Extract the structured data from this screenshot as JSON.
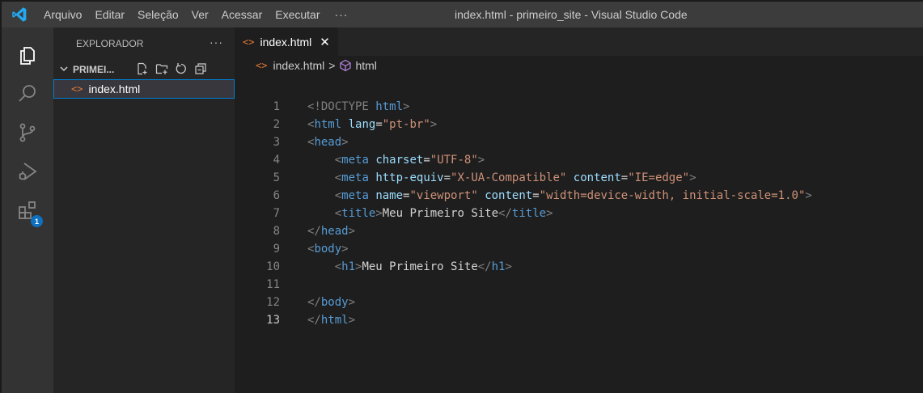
{
  "titlebar": {
    "menu": [
      "Arquivo",
      "Editar",
      "Seleção",
      "Ver",
      "Acessar",
      "Executar"
    ],
    "more": "···",
    "window_title": "index.html - primeiro_site - Visual Studio Code"
  },
  "activitybar": {
    "icons": [
      "explorer-icon",
      "search-icon",
      "source-control-icon",
      "run-debug-icon",
      "extensions-icon"
    ],
    "extensions_badge": "1"
  },
  "sidebar": {
    "title": "EXPLORADOR",
    "more": "···",
    "section": "PRIMEI...",
    "files": [
      {
        "name": "index.html",
        "selected": true
      }
    ]
  },
  "editor": {
    "tab": {
      "label": "index.html",
      "close": "✕"
    },
    "breadcrumb": {
      "file": "index.html",
      "sep": ">",
      "symbol": "html"
    },
    "active_line": 13,
    "lines": [
      {
        "n": "1"
      },
      {
        "n": "2"
      },
      {
        "n": "3"
      },
      {
        "n": "4"
      },
      {
        "n": "5"
      },
      {
        "n": "6"
      },
      {
        "n": "7"
      },
      {
        "n": "8"
      },
      {
        "n": "9"
      },
      {
        "n": "10"
      },
      {
        "n": "11"
      },
      {
        "n": "12"
      },
      {
        "n": "13"
      }
    ],
    "tokens": {
      "doctype_open": "<!DOCTYPE",
      "doctype_html": "html",
      "lang_attr": "lang",
      "lang_value": "\"pt-br\"",
      "charset_attr": "charset",
      "charset_value": "\"UTF-8\"",
      "httpequiv_attr": "http-equiv",
      "httpequiv_value": "\"X-UA-Compatible\"",
      "content_attr": "content",
      "content_value_1": "\"IE=edge\"",
      "name_attr": "name",
      "name_value": "\"viewport\"",
      "content_value_2": "\"width=device-width, initial-scale=1.0\"",
      "title_text": "Meu Primeiro Site",
      "h1_text": "Meu Primeiro Site",
      "tag_html": "html",
      "tag_head": "head",
      "tag_meta": "meta",
      "tag_title": "title",
      "tag_body": "body",
      "tag_h1": "h1"
    }
  },
  "colors": {
    "titlebar": "#3c3c3c",
    "activitybar": "#333333",
    "sidebar": "#252526",
    "editor": "#1e1e1e",
    "tag": "#569cd6",
    "attribute": "#9cdcfe",
    "string": "#ce9178",
    "html_icon": "#e37933",
    "badge": "#0e70c0",
    "selection_border": "#007fd4"
  }
}
